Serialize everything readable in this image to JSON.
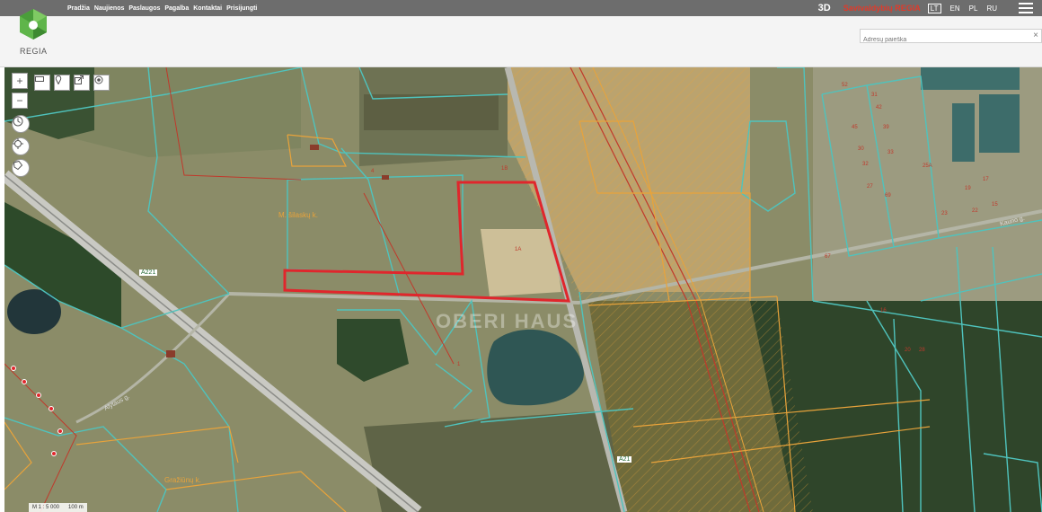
{
  "nav": {
    "items": [
      "Pradžia",
      "Naujienos",
      "Paslaugos",
      "Pagalba",
      "Kontaktai",
      "Prisijungti"
    ]
  },
  "topbar": {
    "mode_3d": "3D",
    "brand": "Savivaldybių REGIA",
    "languages": [
      "LT",
      "EN",
      "PL",
      "RU"
    ],
    "active_language": "LT"
  },
  "logo": {
    "text": "REGIA"
  },
  "search": {
    "placeholder": "Adresų paieška",
    "clear": "×"
  },
  "map": {
    "labels": {
      "village1": "M. šilaskų k.",
      "village2": "Gražiūnų k.",
      "road_badge1": "A221",
      "road_badge2": "A21",
      "road_side": "Alytaus g.",
      "road_right": "Kauno g.",
      "watermark": "OBERI HAUS"
    },
    "parcel_numbers": {
      "p1A": "1A",
      "p1B": "1B",
      "p4": "4",
      "p1": "1",
      "p16": "16",
      "p67": "67",
      "p20": "20",
      "p28": "28",
      "p23": "23",
      "p22": "22",
      "p25A": "25A",
      "p19": "19",
      "p15": "15",
      "p17": "17",
      "p27": "27",
      "p69": "69",
      "p45": "45",
      "p42": "42",
      "p39": "39",
      "p33": "33",
      "p31": "31",
      "p30": "30",
      "p32": "32",
      "p52": "52"
    },
    "scale": {
      "ratio": "M 1 : 5 000",
      "distance": "100 m"
    },
    "colors": {
      "parcel_outline": "#4fc3bd",
      "protected_zone": "#e8a33b",
      "highlight": "#e0262c",
      "utility_line": "#c0392b"
    }
  },
  "tools": {
    "zoom_in": "+",
    "zoom_out": "−"
  }
}
